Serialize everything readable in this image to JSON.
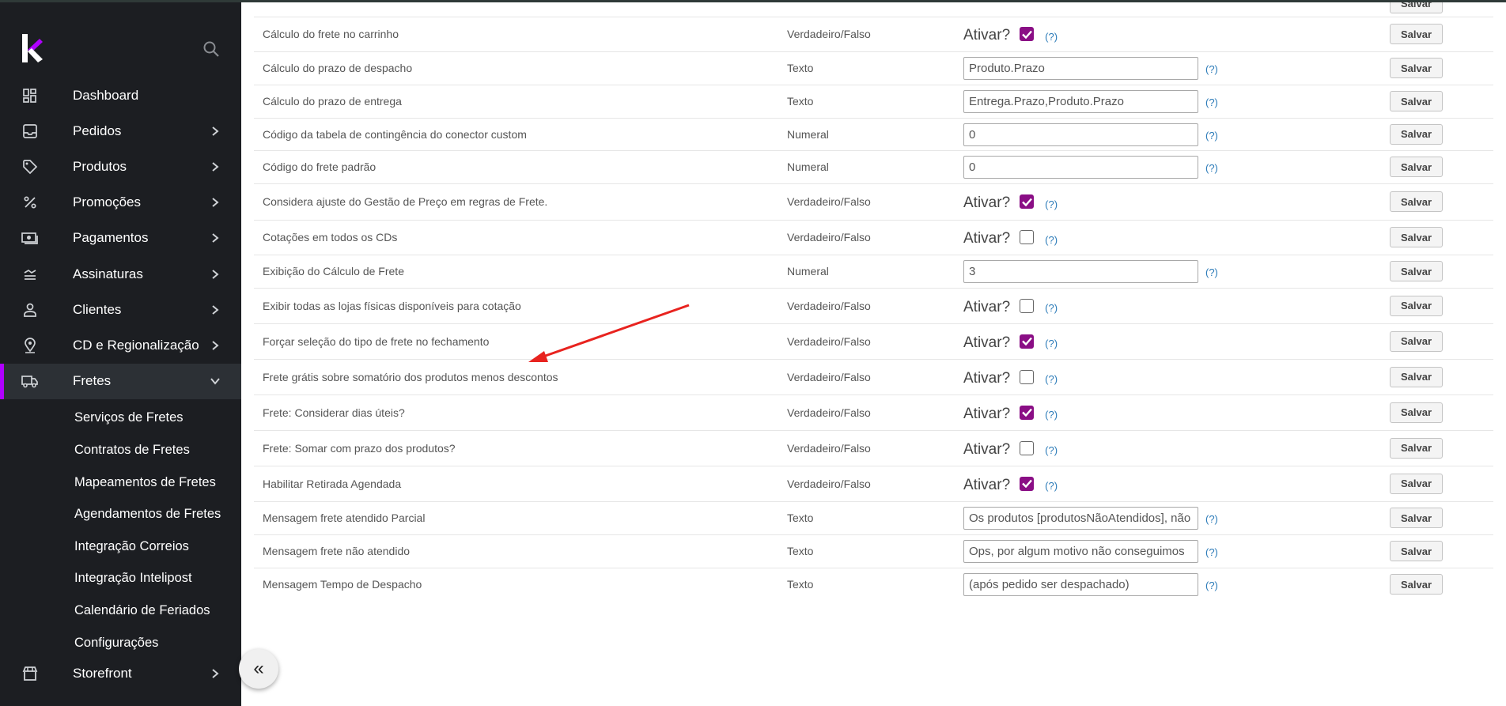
{
  "sidebar": {
    "items": [
      {
        "label": "Dashboard",
        "icon": "dashboard-icon",
        "chevron": false
      },
      {
        "label": "Pedidos",
        "icon": "inbox-icon",
        "chevron": true
      },
      {
        "label": "Produtos",
        "icon": "tag-icon",
        "chevron": true
      },
      {
        "label": "Promoções",
        "icon": "percent-icon",
        "chevron": true
      },
      {
        "label": "Pagamentos",
        "icon": "money-icon",
        "chevron": true
      },
      {
        "label": "Assinaturas",
        "icon": "subscriptions-icon",
        "chevron": true
      },
      {
        "label": "Clientes",
        "icon": "user-icon",
        "chevron": true
      },
      {
        "label": "CD e Regionalização",
        "icon": "location-icon",
        "chevron": true
      },
      {
        "label": "Fretes",
        "icon": "truck-icon",
        "chevron": true,
        "active": true
      }
    ],
    "fretes_sub": [
      "Serviços de Fretes",
      "Contratos de Fretes",
      "Mapeamentos de Fretes",
      "Agendamentos de Fretes",
      "Integração Correios",
      "Integração Intelipost",
      "Calendário de Feriados",
      "Configurações"
    ],
    "storefront": "Storefront",
    "collapse_icon": "«"
  },
  "labels": {
    "ativar": "Ativar?",
    "help": "(?)",
    "save": "Salvar"
  },
  "rows": [
    {
      "name": "Cálculo do frete no carrinho",
      "type": "Verdadeiro/Falso",
      "kind": "bool",
      "checked": true
    },
    {
      "name": "Cálculo do prazo de despacho",
      "type": "Texto",
      "kind": "text",
      "value": "Produto.Prazo"
    },
    {
      "name": "Cálculo do prazo de entrega",
      "type": "Texto",
      "kind": "text",
      "value": "Entrega.Prazo,Produto.Prazo"
    },
    {
      "name": "Código da tabela de contingência do conector custom",
      "type": "Numeral",
      "kind": "text",
      "value": "0"
    },
    {
      "name": "Código do frete padrão",
      "type": "Numeral",
      "kind": "text",
      "value": "0"
    },
    {
      "name": "Considera ajuste do Gestão de Preço em regras de Frete.",
      "type": "Verdadeiro/Falso",
      "kind": "bool",
      "checked": true
    },
    {
      "name": "Cotações em todos os CDs",
      "type": "Verdadeiro/Falso",
      "kind": "bool",
      "checked": false
    },
    {
      "name": "Exibição do Cálculo de Frete",
      "type": "Numeral",
      "kind": "text",
      "value": "3"
    },
    {
      "name": "Exibir todas as lojas físicas disponíveis para cotação",
      "type": "Verdadeiro/Falso",
      "kind": "bool",
      "checked": false
    },
    {
      "name": "Forçar seleção do tipo de frete no fechamento",
      "type": "Verdadeiro/Falso",
      "kind": "bool",
      "checked": true
    },
    {
      "name": "Frete grátis sobre somatório dos produtos menos descontos",
      "type": "Verdadeiro/Falso",
      "kind": "bool",
      "checked": false
    },
    {
      "name": "Frete: Considerar dias úteis?",
      "type": "Verdadeiro/Falso",
      "kind": "bool",
      "checked": true
    },
    {
      "name": "Frete: Somar com prazo dos produtos?",
      "type": "Verdadeiro/Falso",
      "kind": "bool",
      "checked": false
    },
    {
      "name": "Habilitar Retirada Agendada",
      "type": "Verdadeiro/Falso",
      "kind": "bool",
      "checked": true
    },
    {
      "name": "Mensagem frete atendido Parcial",
      "type": "Texto",
      "kind": "text",
      "value": "Os produtos [produtosNãoAtendidos], não"
    },
    {
      "name": "Mensagem frete não atendido",
      "type": "Texto",
      "kind": "text",
      "value": "Ops, por algum motivo não conseguimos"
    },
    {
      "name": "Mensagem Tempo de Despacho",
      "type": "Texto",
      "kind": "text",
      "value": "(após pedido ser despachado)"
    }
  ],
  "colors": {
    "sidebar_bg": "#1c1e22",
    "accent": "#b000ff",
    "checkbox": "#8a0e85",
    "arrow": "#e8231f"
  }
}
